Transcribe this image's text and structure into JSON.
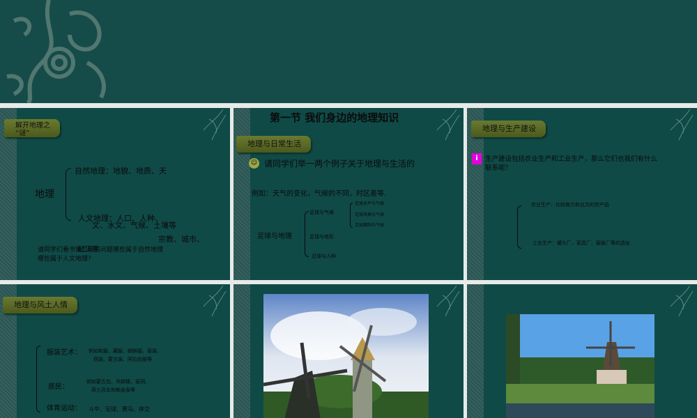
{
  "slides": [
    {
      "tab": "解开地理之\n“谜”",
      "center": "地理",
      "nature": "自然地理：地貌、地质、天",
      "human": "人文地理：人口、人种、",
      "overlap": "文、水文、气候、土壤等",
      "religion": "宗教、城市、",
      "economy": "经济等",
      "question1": "请同学们看书第二段的问题哪些属于自然地理",
      "question2": "哪些属于人文地理？"
    },
    {
      "title": "第一节  我们身边的地理知识",
      "tab": "地理与日常生活",
      "prompt": "请同学们举一两个例子关于地理与生活的",
      "example": "例如：天气的变化，气候的不同，时区差等.",
      "root": "足球与地理",
      "branches": [
        "足球与气候",
        "足球与地形",
        "足球与人种"
      ],
      "sub": [
        "足球水平与气候",
        "足球风格与气候",
        "足球赛制与气候"
      ]
    },
    {
      "tab": "地理与生产建设",
      "question": "生产建设包括农业生产和工业生产，那么它们也我们有什么联系呢？",
      "agri": "农业生产：比较南方和北方的农产品",
      "industry": "工业生产：罐头厂、家具厂、服装厂等的选址"
    },
    {
      "tab": "地理与风土人情",
      "items": [
        {
          "label": "服装艺术：",
          "text1": "例如和服、藏服、朝鲜服、唐装、",
          "text2": "西装、蒙古装、阿拉伯服等"
        },
        {
          "label": "居民：",
          "text1": "例如蒙古包、吊脚楼、窑洞、",
          "text2": "荷兰风车和郁金香等"
        },
        {
          "label": "体育运动：",
          "text1": "斗牛、足球、赛马、摔交"
        }
      ]
    }
  ],
  "colors": {
    "slide_bg": "#0f4a47",
    "tab": "#5a6a26",
    "info_icon": "#e000e0"
  }
}
